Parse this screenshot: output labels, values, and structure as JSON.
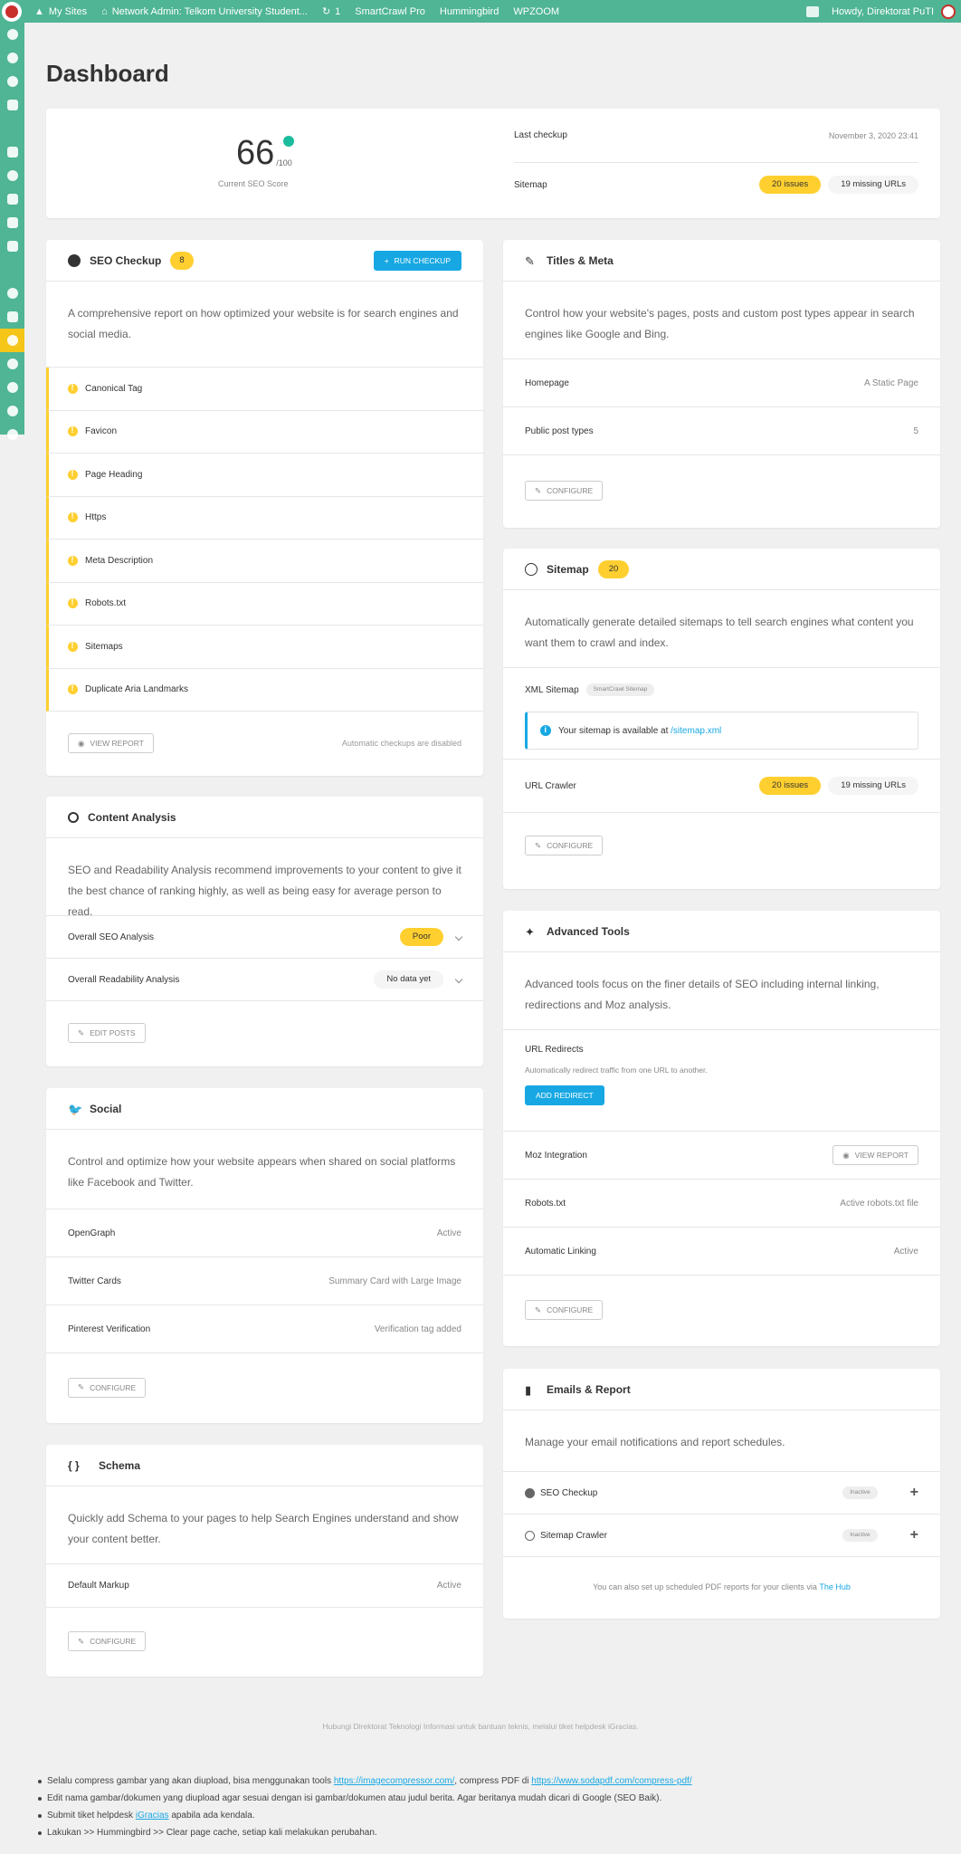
{
  "admin_bar": {
    "my_sites": "My Sites",
    "network_admin": "Network Admin: Telkom University Student...",
    "updates_count": "1",
    "smartcrawl": "SmartCrawl Pro",
    "hummingbird": "Hummingbird",
    "wpzoom": "WPZOOM",
    "howdy": "Howdy, Direktorat PuTI"
  },
  "page_title": "Dashboard",
  "score_box": {
    "score": "66",
    "score_max": "/100",
    "score_label": "Current SEO Score",
    "last_checkup_label": "Last checkup",
    "last_checkup_value": "November 3, 2020 23:41",
    "sitemap_label": "Sitemap",
    "sitemap_issues": "20 issues",
    "sitemap_missing": "19 missing URLs"
  },
  "seo_checkup": {
    "title": "SEO Checkup",
    "count": "8",
    "run_button": "RUN CHECKUP",
    "description": "A comprehensive report on how optimized your website is for search engines and social media.",
    "items": [
      "Canonical Tag",
      "Favicon",
      "Page Heading",
      "Https",
      "Meta Description",
      "Robots.txt",
      "Sitemaps",
      "Duplicate Aria Landmarks"
    ],
    "view_report": "VIEW REPORT",
    "auto_note": "Automatic checkups are disabled"
  },
  "titles_meta": {
    "title": "Titles & Meta",
    "description": "Control how your website's pages, posts and custom post types appear in search engines like Google and Bing.",
    "homepage_label": "Homepage",
    "homepage_value": "A Static Page",
    "post_types_label": "Public post types",
    "post_types_value": "5",
    "configure": "CONFIGURE"
  },
  "sitemap": {
    "title": "Sitemap",
    "count": "20",
    "description": "Automatically generate detailed sitemaps to tell search engines what content you want them to crawl and index.",
    "xml_label": "XML Sitemap",
    "xml_badge": "SmartCrawl Sitemap",
    "info_text": "Your sitemap is available at",
    "info_link": "/sitemap.xml",
    "crawler_label": "URL Crawler",
    "crawler_issues": "20 issues",
    "crawler_missing": "19 missing URLs",
    "configure": "CONFIGURE"
  },
  "content_analysis": {
    "title": "Content Analysis",
    "description": "SEO and Readability Analysis recommend improvements to your content to give it the best chance of ranking highly, as well as being easy for average person to read.",
    "seo_label": "Overall SEO Analysis",
    "seo_value": "Poor",
    "readability_label": "Overall Readability Analysis",
    "readability_value": "No data yet",
    "edit_posts": "EDIT POSTS"
  },
  "advanced_tools": {
    "title": "Advanced Tools",
    "description": "Advanced tools focus on the finer details of SEO including internal linking, redirections and Moz analysis.",
    "redirects_label": "URL Redirects",
    "redirects_desc": "Automatically redirect traffic from one URL to another.",
    "add_redirect": "ADD REDIRECT",
    "moz_label": "Moz Integration",
    "moz_button": "VIEW REPORT",
    "robots_label": "Robots.txt",
    "robots_value": "Active robots.txt file",
    "linking_label": "Automatic Linking",
    "linking_value": "Active",
    "configure": "CONFIGURE"
  },
  "social": {
    "title": "Social",
    "description": "Control and optimize how your website appears when shared on social platforms like Facebook and Twitter.",
    "og_label": "OpenGraph",
    "og_value": "Active",
    "twitter_label": "Twitter Cards",
    "twitter_value": "Summary Card with Large Image",
    "pinterest_label": "Pinterest Verification",
    "pinterest_value": "Verification tag added",
    "configure": "CONFIGURE"
  },
  "emails_report": {
    "title": "Emails & Report",
    "description": "Manage your email notifications and report schedules.",
    "seo_checkup": "SEO Checkup",
    "sitemap_crawler": "Sitemap Crawler",
    "inactive": "Inactive",
    "footer_text": "You can also set up scheduled PDF reports for your clients via",
    "footer_link": "The Hub"
  },
  "schema": {
    "title": "Schema",
    "description": "Quickly add Schema to your pages to help Search Engines understand and show your content better.",
    "markup_label": "Default Markup",
    "markup_value": "Active",
    "configure": "CONFIGURE"
  },
  "footer": {
    "contact": "Hubungi Direktorat Teknologi Informasi untuk bantuan teknis, melalui tiket helpdesk iGracias.",
    "note1_text": "Selalu compress gambar yang akan diupload, bisa menggunakan tools",
    "note1_link1": "https://imagecompressor.com/",
    "note1_mid": ", compress PDF di",
    "note1_link2": "https://www.sodapdf.com/compress-pdf/",
    "note2": "Edit nama gambar/dokumen yang diupload agar sesuai dengan isi gambar/dokumen atau judul berita. Agar beritanya mudah dicari di Google (SEO Baik).",
    "note3_pre": "Submit tiket helpdesk",
    "note3_link": "iGracias",
    "note3_post": "apabila ada kendala.",
    "note4": "Lakukan >> Hummingbird >> Clear page cache, setiap kali melakukan perubahan."
  },
  "colors": {
    "accent": "#4fb594",
    "warning": "#fecf2f",
    "primary": "#17a8e3"
  }
}
